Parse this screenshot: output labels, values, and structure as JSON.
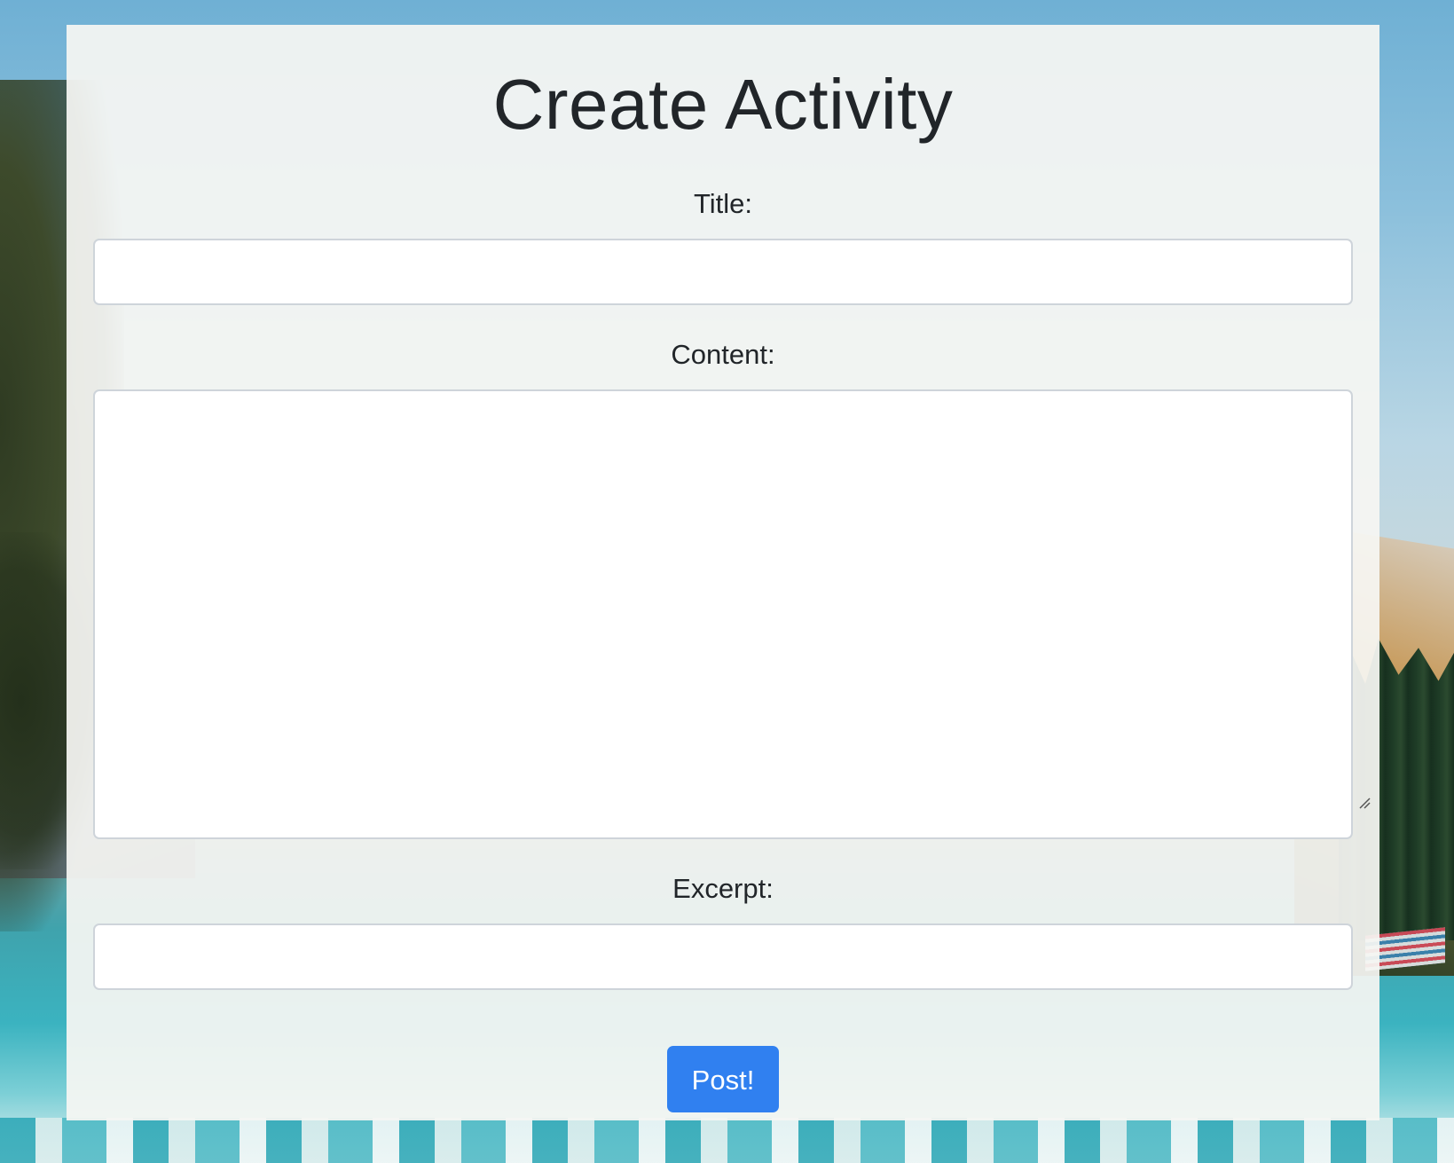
{
  "form": {
    "heading": "Create Activity",
    "fields": {
      "title": {
        "label": "Title:",
        "value": "",
        "placeholder": ""
      },
      "content": {
        "label": "Content:",
        "value": "",
        "placeholder": ""
      },
      "excerpt": {
        "label": "Excerpt:",
        "value": "",
        "placeholder": ""
      }
    },
    "submit_label": "Post!"
  },
  "colors": {
    "accent": "#3080f0",
    "text": "#212529",
    "input_border": "#ced4da",
    "panel_background": "#f6f6f3"
  },
  "icons": {
    "resize_handle": "resize-grip-icon"
  }
}
